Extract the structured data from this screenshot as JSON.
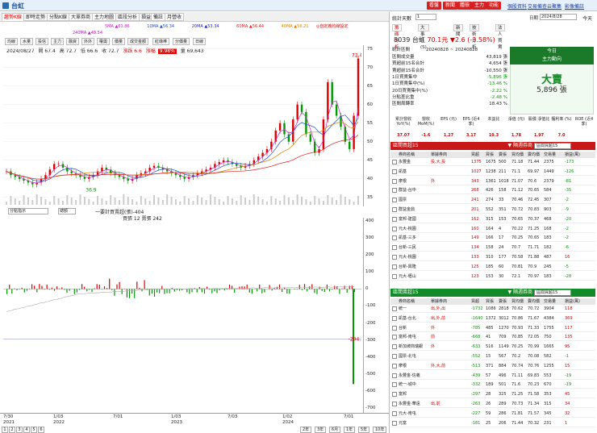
{
  "window": {
    "title": "台虹",
    "top_red": [
      "看盤",
      "新聞",
      "體檢",
      "主力",
      "功能"
    ],
    "top_links": [
      "個股資料",
      "交易備查",
      "云聚集",
      "影像備註"
    ]
  },
  "tabs": [
    "趨勢K線",
    "即時走勢",
    "分點K線",
    "大單券商",
    "主力地圖",
    "區段分析",
    "損益",
    "備註",
    "月營收"
  ],
  "ma": {
    "m5": "5MA ▲61.86",
    "m10": "10MA ▲56.34",
    "m20": "20MA ▲53.34",
    "m60": "60MA ▲56.44",
    "m40": "40MA ▲56.21",
    "m240": "240MA ▲48.54",
    "hint": "◎自定義均線設定"
  },
  "indicators": [
    "均線",
    "水量",
    "投信",
    "主力",
    "融資",
    "外外",
    "權奧",
    "價量",
    "成交金額",
    "紅綠棒",
    "分價量",
    "日線"
  ],
  "info": {
    "date": "2024/08/27",
    "open": "開 67.4",
    "high": "高 72.7",
    "low": "低 66.6",
    "close": "收 72.7",
    "chg": "漲跌 6.6",
    "pct": "漲幅",
    "pct_val": "9.98%",
    "vol": "量 69,643"
  },
  "price_axis": [
    "75",
    "70",
    "65",
    "60",
    "55",
    "50",
    "45",
    "40",
    "35"
  ],
  "price_marks": {
    "high": "72.4",
    "low": "36.9"
  },
  "price_series": [
    42,
    41,
    40.5,
    40,
    39.5,
    39,
    38.5,
    39,
    40,
    41,
    42.5,
    44,
    44,
    43,
    42,
    41.5,
    41,
    40.5,
    40,
    40.5,
    41,
    42,
    43,
    42.5,
    41.5,
    41,
    40.5,
    40,
    39.5,
    40,
    41,
    41.5,
    42,
    43,
    43.5,
    43,
    42.5,
    42,
    41.5,
    41,
    40.5,
    40,
    40.5,
    41,
    41.5,
    42,
    42.5,
    43,
    44,
    44.5,
    45,
    44.5,
    44,
    43.5,
    43,
    43.5,
    44,
    45,
    46,
    47,
    48,
    50,
    53,
    55,
    52,
    50,
    56,
    60,
    58,
    52,
    50,
    47,
    48,
    56,
    66,
    60,
    57,
    54,
    50,
    48,
    57,
    72.4
  ],
  "sub": {
    "sel1": "分點指示",
    "sel2": "總額",
    "label": "一要計買賣超(張)-404",
    "label2": "買張 12 賣張 242"
  },
  "vol_axis": [
    "400",
    "300",
    "200",
    "100",
    "0",
    "-100",
    "-200",
    "-300",
    "-400",
    "-500",
    "-600",
    "-700"
  ],
  "vol_mark": "-294.1",
  "x_axis": [
    {
      "d": "7/30",
      "y": "2021"
    },
    {
      "d": "1/03",
      "y": "2022"
    },
    {
      "d": "7/01",
      "y": ""
    },
    {
      "d": "1/03",
      "y": "2023"
    },
    {
      "d": "7/03",
      "y": ""
    },
    {
      "d": "1/02",
      "y": "2024"
    },
    {
      "d": "7/01",
      "y": ""
    }
  ],
  "bottom_tabs": [
    "1",
    "2",
    "3",
    "4",
    "5",
    "6"
  ],
  "range_tabs": [
    "2年",
    "3年",
    "6月",
    "1年",
    "5年",
    "10年"
  ],
  "right": {
    "stat_label": "統計天數",
    "stat_val": "1",
    "date": "2024/8/28",
    "mode": "今天",
    "tabs": [
      "籌碼分析",
      "大事件(S)",
      "新聞",
      "技術分析",
      "法人買賣"
    ],
    "stock_code": "8039 台虹",
    "price": "70.1元",
    "chg": "▼2.6 (-3.58%)",
    "period_label": "統計區間",
    "period": "20240828 ~ 20240828",
    "kv": [
      [
        "區間成交量",
        "43,819 張"
      ],
      [
        "買超前15名合計",
        "4,654 張"
      ],
      [
        "賣超前15名合計",
        "-10,550 張"
      ],
      [
        "1日買賣集中",
        "-5,896 張"
      ],
      [
        "1日買賣集中(%)",
        "-13.46 %"
      ],
      [
        "20日買賣集中(%)",
        "-2.22 %"
      ],
      [
        "分點差比重",
        "-2.48 %"
      ],
      [
        "區間周轉率",
        "18.43 %"
      ]
    ],
    "big_top1": "今日",
    "big_top2": "主力動向",
    "big_word": "大賣",
    "big_num": "5,896 張",
    "fund_head": [
      "累計營收 YoY(%)",
      "營收 MoM(%)",
      "EPS (元)",
      "EPS (近4季)",
      "本益比",
      "淨值 (元)",
      "股價 淨值比",
      "獲利率 (%)",
      "ROE (近4季)"
    ],
    "fund_vals": [
      "37.07",
      "-1.6",
      "1.27",
      "3.17",
      "19.3",
      "1.78",
      "1.97",
      "7.0",
      ""
    ],
    "buy_title": "區間買超15",
    "sel_label": "▼ 隔週券商",
    "sel_val": "區間買超15",
    "cols": [
      "券商名稱",
      "單據券商",
      "買超",
      "買張",
      "賣張",
      "買均價",
      "賣均價",
      "交易量",
      "損益(萬)"
    ],
    "buy_rows": [
      [
        "永豐金",
        "投,大,投",
        "1375",
        "1675",
        "500",
        "71.18",
        "71.44",
        "2375",
        "-173"
      ],
      [
        "凱基",
        "",
        "1027",
        "1238",
        "211",
        "71.1",
        "69.97",
        "1449",
        "-126"
      ],
      [
        "摩根",
        "外",
        "343",
        "1361",
        "1018",
        "71.07",
        "70.6",
        "2379",
        "-81"
      ],
      [
        "群益-台中",
        "",
        "268",
        "426",
        "158",
        "71.12",
        "70.65",
        "584",
        "-35"
      ],
      [
        "國票",
        "",
        "241",
        "274",
        "33",
        "70.46",
        "72.45",
        "307",
        "-2"
      ],
      [
        "群益金鼎",
        "",
        "201",
        "552",
        "351",
        "70.72",
        "70.83",
        "903",
        "-9"
      ],
      [
        "富邦-建國",
        "",
        "162",
        "315",
        "153",
        "70.65",
        "70.37",
        "468",
        "-20"
      ],
      [
        "元大-桃園",
        "",
        "160",
        "164",
        "4",
        "70.22",
        "71.25",
        "168",
        "-2"
      ],
      [
        "凱基-三多",
        "",
        "149",
        "166",
        "17",
        "70.25",
        "70.65",
        "183",
        "-2"
      ],
      [
        "台新-三民",
        "",
        "134",
        "158",
        "24",
        "70.7",
        "71.71",
        "182",
        "-6"
      ],
      [
        "元大-桃園",
        "",
        "133",
        "310",
        "177",
        "70.58",
        "71.88",
        "487",
        "16"
      ],
      [
        "台新-興隆",
        "",
        "125",
        "185",
        "60",
        "70.81",
        "70.9",
        "245",
        "-5"
      ],
      [
        "元大-壢山",
        "",
        "123",
        "153",
        "30",
        "72.1",
        "70.97",
        "183",
        "-28"
      ]
    ],
    "sell_title": "區間賣超15",
    "sell_rows": [
      [
        "統一",
        "出,外,出",
        "-1732",
        "1086",
        "2818",
        "70.62",
        "70.72",
        "3904",
        "118"
      ],
      [
        "凱基-台北",
        "出,外,前",
        "-1640",
        "1372",
        "3012",
        "70.86",
        "71.67",
        "4384",
        "369"
      ],
      [
        "台新",
        "外",
        "-785",
        "485",
        "1270",
        "70.93",
        "71.33",
        "1755",
        "117"
      ],
      [
        "富邦-南屯",
        "前",
        "-668",
        "41",
        "709",
        "70.85",
        "72.05",
        "750",
        "135"
      ],
      [
        "新加坡商瑞銀",
        "外",
        "-633",
        "516",
        "1149",
        "70.25",
        "70.99",
        "1665",
        "95"
      ],
      [
        "國票-北屯",
        "",
        "-552",
        "15",
        "567",
        "70.2",
        "70.08",
        "582",
        "-1"
      ],
      [
        "摩根",
        "外,大,前",
        "-513",
        "371",
        "884",
        "70.74",
        "70.76",
        "1255",
        "15"
      ],
      [
        "永豐金-信義",
        "",
        "-439",
        "57",
        "496",
        "71.11",
        "69.83",
        "553",
        "-19"
      ],
      [
        "統一-城中",
        "",
        "-332",
        "189",
        "501",
        "71.6",
        "70.23",
        "670",
        "-19"
      ],
      [
        "富邦",
        "",
        "-297",
        "28",
        "325",
        "71.25",
        "71.58",
        "353",
        "45"
      ],
      [
        "永豐金-華遠",
        "出,前",
        "-263",
        "26",
        "289",
        "70.73",
        "71.34",
        "315",
        "34"
      ],
      [
        "元大-南屯",
        "",
        "-227",
        "59",
        "286",
        "71.81",
        "71.57",
        "345",
        "32"
      ],
      [
        "元富",
        "",
        "-181",
        "25",
        "206",
        "71.44",
        "70.32",
        "231",
        "1"
      ]
    ]
  }
}
